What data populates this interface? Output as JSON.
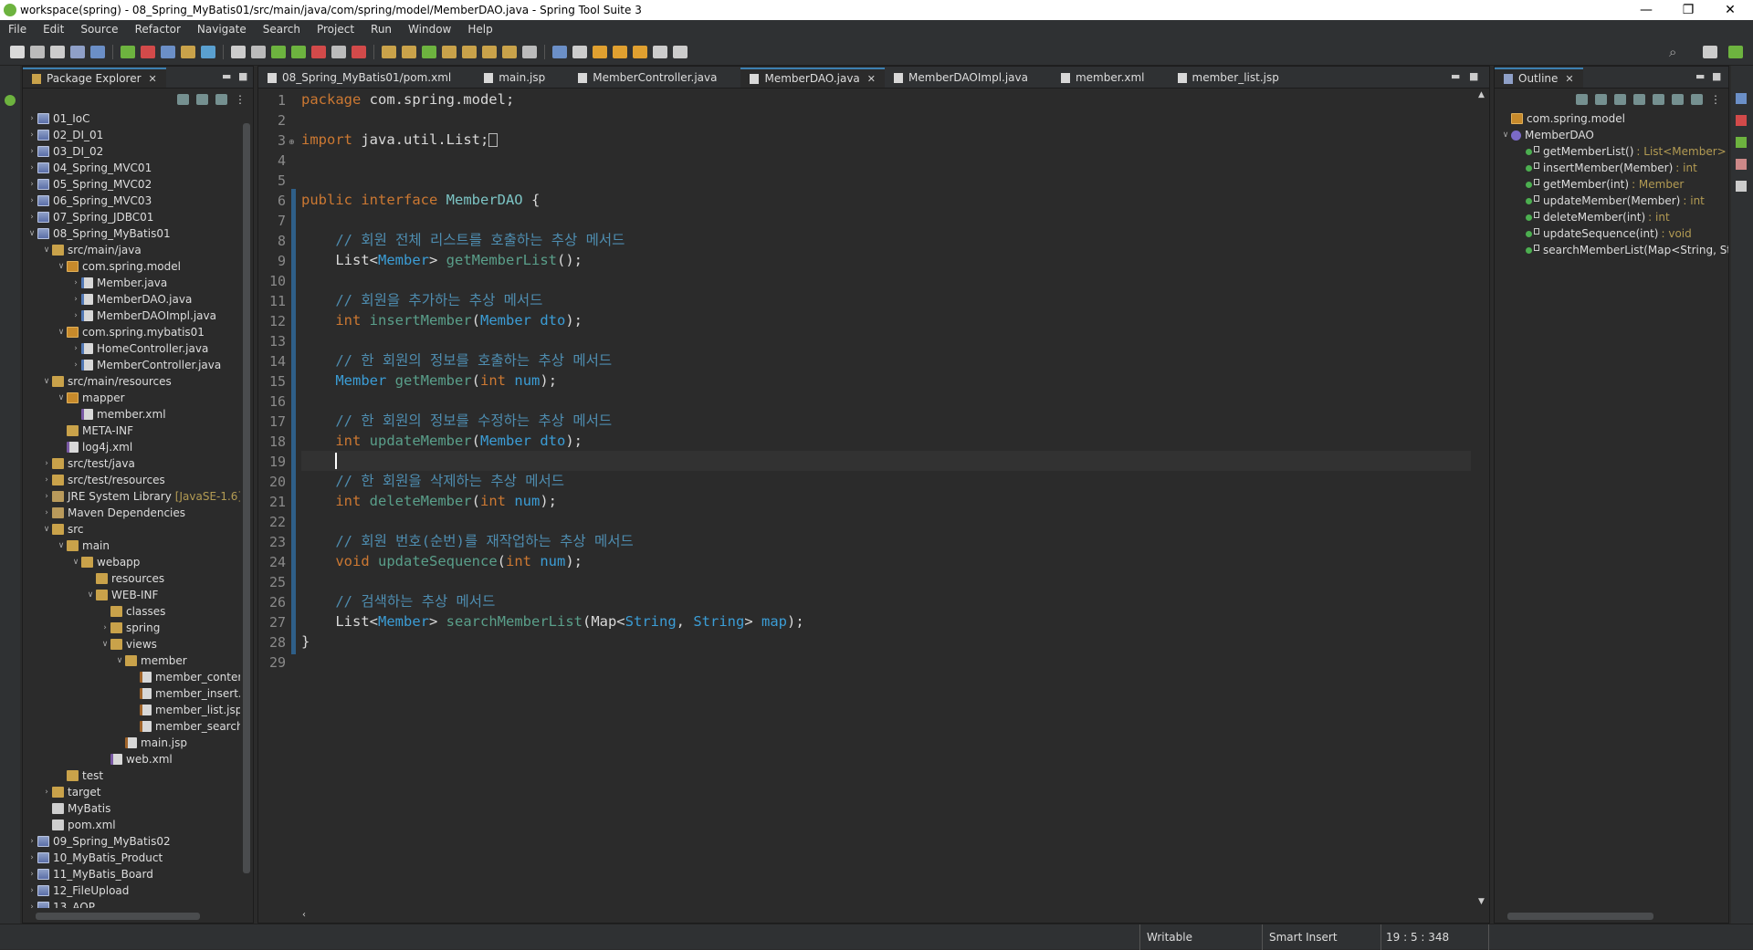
{
  "window": {
    "title": "workspace(spring) - 08_Spring_MyBatis01/src/main/java/com/spring/model/MemberDAO.java - Spring Tool Suite 3"
  },
  "menu": [
    "File",
    "Edit",
    "Source",
    "Refactor",
    "Navigate",
    "Search",
    "Project",
    "Run",
    "Window",
    "Help"
  ],
  "package_explorer": {
    "title": "Package Explorer",
    "tree": [
      {
        "label": "01_IoC",
        "icon": "project",
        "depth": 0,
        "toggle": ">"
      },
      {
        "label": "02_DI_01",
        "icon": "project",
        "depth": 0,
        "toggle": ">"
      },
      {
        "label": "03_DI_02",
        "icon": "project",
        "depth": 0,
        "toggle": ">"
      },
      {
        "label": "04_Spring_MVC01",
        "icon": "project",
        "depth": 0,
        "toggle": ">"
      },
      {
        "label": "05_Spring_MVC02",
        "icon": "project",
        "depth": 0,
        "toggle": ">"
      },
      {
        "label": "06_Spring_MVC03",
        "icon": "project",
        "depth": 0,
        "toggle": ">"
      },
      {
        "label": "07_Spring_JDBC01",
        "icon": "project",
        "depth": 0,
        "toggle": ">"
      },
      {
        "label": "08_Spring_MyBatis01",
        "icon": "project",
        "depth": 0,
        "toggle": "v"
      },
      {
        "label": "src/main/java",
        "icon": "folder",
        "depth": 1,
        "toggle": "v"
      },
      {
        "label": "com.spring.model",
        "icon": "pkg",
        "depth": 2,
        "toggle": "v"
      },
      {
        "label": "Member.java",
        "icon": "java",
        "depth": 3,
        "toggle": ">"
      },
      {
        "label": "MemberDAO.java",
        "icon": "java",
        "depth": 3,
        "toggle": ">"
      },
      {
        "label": "MemberDAOImpl.java",
        "icon": "java",
        "depth": 3,
        "toggle": ">"
      },
      {
        "label": "com.spring.mybatis01",
        "icon": "pkg",
        "depth": 2,
        "toggle": "v"
      },
      {
        "label": "HomeController.java",
        "icon": "java",
        "depth": 3,
        "toggle": ">"
      },
      {
        "label": "MemberController.java",
        "icon": "java",
        "depth": 3,
        "toggle": ">"
      },
      {
        "label": "src/main/resources",
        "icon": "folder",
        "depth": 1,
        "toggle": "v"
      },
      {
        "label": "mapper",
        "icon": "pkg",
        "depth": 2,
        "toggle": "v"
      },
      {
        "label": "member.xml",
        "icon": "xml",
        "depth": 3,
        "toggle": ""
      },
      {
        "label": "META-INF",
        "icon": "folder",
        "depth": 2,
        "toggle": ""
      },
      {
        "label": "log4j.xml",
        "icon": "xml",
        "depth": 2,
        "toggle": ""
      },
      {
        "label": "src/test/java",
        "icon": "folder",
        "depth": 1,
        "toggle": ">"
      },
      {
        "label": "src/test/resources",
        "icon": "folder",
        "depth": 1,
        "toggle": ">"
      },
      {
        "label": "JRE System Library",
        "icon": "lib",
        "depth": 1,
        "toggle": ">",
        "decoration": "[JavaSE-1.6]"
      },
      {
        "label": "Maven Dependencies",
        "icon": "lib",
        "depth": 1,
        "toggle": ">"
      },
      {
        "label": "src",
        "icon": "folder",
        "depth": 1,
        "toggle": "v"
      },
      {
        "label": "main",
        "icon": "folder",
        "depth": 2,
        "toggle": "v"
      },
      {
        "label": "webapp",
        "icon": "folder",
        "depth": 3,
        "toggle": "v"
      },
      {
        "label": "resources",
        "icon": "folder",
        "depth": 4,
        "toggle": ""
      },
      {
        "label": "WEB-INF",
        "icon": "folder",
        "depth": 4,
        "toggle": "v"
      },
      {
        "label": "classes",
        "icon": "folder",
        "depth": 5,
        "toggle": ""
      },
      {
        "label": "spring",
        "icon": "folder",
        "depth": 5,
        "toggle": ">"
      },
      {
        "label": "views",
        "icon": "folder",
        "depth": 5,
        "toggle": "v"
      },
      {
        "label": "member",
        "icon": "folder",
        "depth": 6,
        "toggle": "v"
      },
      {
        "label": "member_conten",
        "icon": "jsp",
        "depth": 7,
        "toggle": ""
      },
      {
        "label": "member_insert.j",
        "icon": "jsp",
        "depth": 7,
        "toggle": ""
      },
      {
        "label": "member_list.jsp",
        "icon": "jsp",
        "depth": 7,
        "toggle": ""
      },
      {
        "label": "member_searchl",
        "icon": "jsp",
        "depth": 7,
        "toggle": ""
      },
      {
        "label": "main.jsp",
        "icon": "jsp",
        "depth": 6,
        "toggle": ""
      },
      {
        "label": "web.xml",
        "icon": "xml",
        "depth": 5,
        "toggle": ""
      },
      {
        "label": "test",
        "icon": "folder",
        "depth": 2,
        "toggle": ""
      },
      {
        "label": "target",
        "icon": "folder",
        "depth": 1,
        "toggle": ">"
      },
      {
        "label": "MyBatis",
        "icon": "file",
        "depth": 1,
        "toggle": ""
      },
      {
        "label": "pom.xml",
        "icon": "file",
        "depth": 1,
        "toggle": ""
      },
      {
        "label": "09_Spring_MyBatis02",
        "icon": "project",
        "depth": 0,
        "toggle": ">"
      },
      {
        "label": "10_MyBatis_Product",
        "icon": "project",
        "depth": 0,
        "toggle": ">"
      },
      {
        "label": "11_MyBatis_Board",
        "icon": "project",
        "depth": 0,
        "toggle": ">"
      },
      {
        "label": "12_FileUpload",
        "icon": "project",
        "depth": 0,
        "toggle": ">"
      },
      {
        "label": "13_AOP",
        "icon": "project",
        "depth": 0,
        "toggle": ">"
      }
    ]
  },
  "editor": {
    "tabs": [
      {
        "label": "08_Spring_MyBatis01/pom.xml",
        "active": false
      },
      {
        "label": "main.jsp",
        "active": false
      },
      {
        "label": "MemberController.java",
        "active": false
      },
      {
        "label": "MemberDAO.java",
        "active": true
      },
      {
        "label": "MemberDAOImpl.java",
        "active": false
      },
      {
        "label": "member.xml",
        "active": false
      },
      {
        "label": "member_list.jsp",
        "active": false
      }
    ],
    "lines": [
      [
        [
          "kw",
          "package"
        ],
        [
          "pl",
          " com.spring.model;"
        ]
      ],
      [],
      [
        [
          "kw",
          "import"
        ],
        [
          "pl",
          " java.util.List;"
        ],
        [
          "box",
          ""
        ]
      ],
      [],
      [],
      [
        [
          "kw",
          "public interface"
        ],
        [
          "pl",
          " "
        ],
        [
          "iface",
          "MemberDAO"
        ],
        [
          "pl",
          " {"
        ]
      ],
      [],
      [
        [
          "pl",
          "    "
        ],
        [
          "cm",
          "// 회원 전체 리스트를 호출하는 추상 메서드"
        ]
      ],
      [
        [
          "pl",
          "    "
        ],
        [
          "pl",
          "List"
        ],
        [
          "pl",
          "<"
        ],
        [
          "ty",
          "Member"
        ],
        [
          "pl",
          "> "
        ],
        [
          "mt",
          "getMemberList"
        ],
        [
          "pl",
          "();"
        ]
      ],
      [],
      [
        [
          "pl",
          "    "
        ],
        [
          "cm",
          "// 회원을 추가하는 추상 메서드"
        ]
      ],
      [
        [
          "pl",
          "    "
        ],
        [
          "kw",
          "int"
        ],
        [
          "pl",
          " "
        ],
        [
          "mt",
          "insertMember"
        ],
        [
          "pl",
          "("
        ],
        [
          "ty",
          "Member"
        ],
        [
          "pl",
          " "
        ],
        [
          "ty",
          "dto"
        ],
        [
          "pl",
          ");"
        ]
      ],
      [],
      [
        [
          "pl",
          "    "
        ],
        [
          "cm",
          "// 한 회원의 정보를 호출하는 추상 메서드"
        ]
      ],
      [
        [
          "pl",
          "    "
        ],
        [
          "ty",
          "Member"
        ],
        [
          "pl",
          " "
        ],
        [
          "mt",
          "getMember"
        ],
        [
          "pl",
          "("
        ],
        [
          "kw",
          "int"
        ],
        [
          "pl",
          " "
        ],
        [
          "ty",
          "num"
        ],
        [
          "pl",
          ");"
        ]
      ],
      [],
      [
        [
          "pl",
          "    "
        ],
        [
          "cm",
          "// 한 회원의 정보를 수정하는 추상 메서드"
        ]
      ],
      [
        [
          "pl",
          "    "
        ],
        [
          "kw",
          "int"
        ],
        [
          "pl",
          " "
        ],
        [
          "mt",
          "updateMember"
        ],
        [
          "pl",
          "("
        ],
        [
          "ty",
          "Member"
        ],
        [
          "pl",
          " "
        ],
        [
          "ty",
          "dto"
        ],
        [
          "pl",
          ");"
        ]
      ],
      [],
      [
        [
          "pl",
          "    "
        ],
        [
          "cm",
          "// 한 회원을 삭제하는 추상 메서드"
        ]
      ],
      [
        [
          "pl",
          "    "
        ],
        [
          "kw",
          "int"
        ],
        [
          "pl",
          " "
        ],
        [
          "mt",
          "deleteMember"
        ],
        [
          "pl",
          "("
        ],
        [
          "kw",
          "int"
        ],
        [
          "pl",
          " "
        ],
        [
          "ty",
          "num"
        ],
        [
          "pl",
          ");"
        ]
      ],
      [],
      [
        [
          "pl",
          "    "
        ],
        [
          "cm",
          "// 회원 번호(순번)를 재작업하는 추상 메서드"
        ]
      ],
      [
        [
          "pl",
          "    "
        ],
        [
          "kw",
          "void"
        ],
        [
          "pl",
          " "
        ],
        [
          "mt",
          "updateSequence"
        ],
        [
          "pl",
          "("
        ],
        [
          "kw",
          "int"
        ],
        [
          "pl",
          " "
        ],
        [
          "ty",
          "num"
        ],
        [
          "pl",
          ");"
        ]
      ],
      [],
      [
        [
          "pl",
          "    "
        ],
        [
          "cm",
          "// 검색하는 추상 메서드"
        ]
      ],
      [
        [
          "pl",
          "    "
        ],
        [
          "pl",
          "List"
        ],
        [
          "pl",
          "<"
        ],
        [
          "ty",
          "Member"
        ],
        [
          "pl",
          "> "
        ],
        [
          "mt",
          "searchMemberList"
        ],
        [
          "pl",
          "(Map<"
        ],
        [
          "ty",
          "String"
        ],
        [
          "pl",
          ", "
        ],
        [
          "ty",
          "String"
        ],
        [
          "pl",
          "> "
        ],
        [
          "ty",
          "map"
        ],
        [
          "pl",
          ");"
        ]
      ],
      [
        [
          "pl",
          "}"
        ]
      ],
      []
    ],
    "current_line": 19
  },
  "outline": {
    "title": "Outline",
    "items": [
      {
        "label": "com.spring.model",
        "type": "",
        "kind": "package",
        "depth": 0,
        "toggle": ""
      },
      {
        "label": "MemberDAO",
        "type": "",
        "kind": "interface",
        "depth": 0,
        "toggle": "v"
      },
      {
        "label": "getMemberList()",
        "type": ": List<Member>",
        "kind": "method",
        "depth": 1,
        "toggle": ""
      },
      {
        "label": "insertMember(Member)",
        "type": ": int",
        "kind": "method",
        "depth": 1,
        "toggle": ""
      },
      {
        "label": "getMember(int)",
        "type": ": Member",
        "kind": "method",
        "depth": 1,
        "toggle": ""
      },
      {
        "label": "updateMember(Member)",
        "type": ": int",
        "kind": "method",
        "depth": 1,
        "toggle": ""
      },
      {
        "label": "deleteMember(int)",
        "type": ": int",
        "kind": "method",
        "depth": 1,
        "toggle": ""
      },
      {
        "label": "updateSequence(int)",
        "type": ": void",
        "kind": "method",
        "depth": 1,
        "toggle": ""
      },
      {
        "label": "searchMemberList(Map<String, Stri",
        "type": "",
        "kind": "method",
        "depth": 1,
        "toggle": ""
      }
    ]
  },
  "status": {
    "writable": "Writable",
    "insert_mode": "Smart Insert",
    "position": "19 : 5 : 348"
  },
  "colors": {
    "editor_bg": "#2b2b2b",
    "keyword": "#cc7832",
    "comment": "#4e8db0",
    "type": "#3b9dd6",
    "method": "#5a9f8a",
    "active_tab_border": "#3c7fb1"
  },
  "icons": [
    "minimize-icon",
    "maximize-icon",
    "close-icon",
    "collapse-all-icon",
    "link-with-editor-icon",
    "view-menu-icon",
    "search-icon"
  ]
}
